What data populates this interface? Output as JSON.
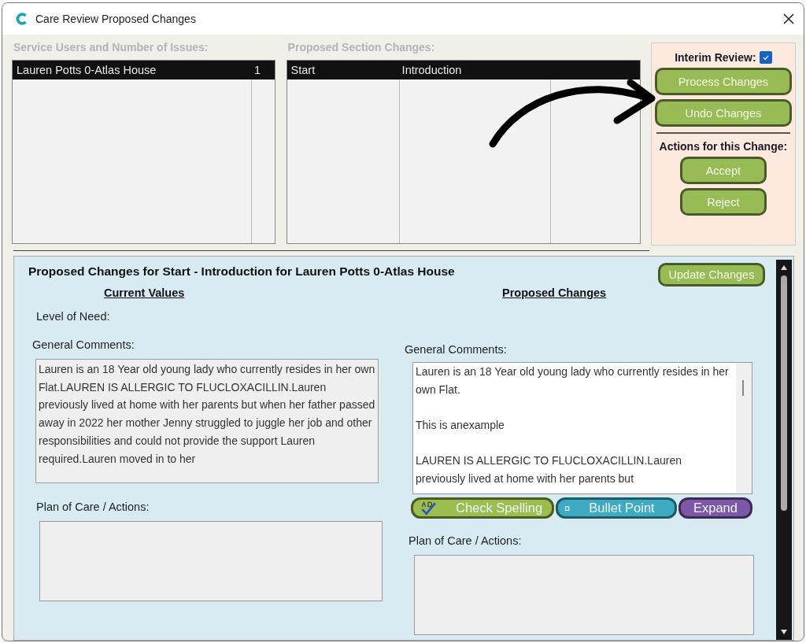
{
  "window": {
    "title": "Care Review Proposed Changes"
  },
  "service_users": {
    "label": "Service Users and Number of Issues:",
    "rows": [
      {
        "name": "Lauren Potts 0-Atlas House",
        "issues": "1",
        "selected": true
      }
    ]
  },
  "section_changes": {
    "label": "Proposed Section Changes:",
    "rows": [
      {
        "section": "Start",
        "subsection": "Introduction",
        "selected": true
      }
    ]
  },
  "review_panel": {
    "interim_review": {
      "label": "Interim Review:",
      "checked": true
    },
    "buttons": [
      "Process Changes",
      "Undo Changes"
    ],
    "actions_label": "Actions for this Change:",
    "action_buttons": [
      "Accept",
      "Reject"
    ]
  },
  "details": {
    "title": "Proposed Changes for Start - Introduction for Lauren Potts 0-Atlas House",
    "update_button": "Update Changes",
    "current": {
      "heading": "Current Values",
      "level_label": "Level of Need:",
      "comments_label": "General Comments:",
      "comments": "Lauren is an 18 Year old young lady who currently resides in her own Flat.LAUREN IS ALLERGIC TO FLUCLOXACILLIN.Lauren previously lived at home with her parents but when her father passed away in 2022 her mother Jenny struggled to juggle her job and other responsibilities and could not provide the support Lauren required.Lauren moved in to her",
      "plan_label": "Plan of Care / Actions:"
    },
    "proposed": {
      "heading": "Proposed Changes",
      "comments_label": "General Comments:",
      "comments_paragraphs": [
        "Lauren is an 18 Year old young lady who currently resides in her own Flat.",
        " This is anexample",
        "LAUREN IS ALLERGIC TO FLUCLOXACILLIN.Lauren previously lived at home with her parents but"
      ],
      "tools": [
        {
          "kind": "spell",
          "label": "Check Spelling"
        },
        {
          "kind": "bullet",
          "icon": "¤",
          "label": "Bullet Point"
        },
        {
          "kind": "expand",
          "label": "Expand"
        }
      ],
      "plan_label": "Plan of Care / Actions:"
    }
  }
}
